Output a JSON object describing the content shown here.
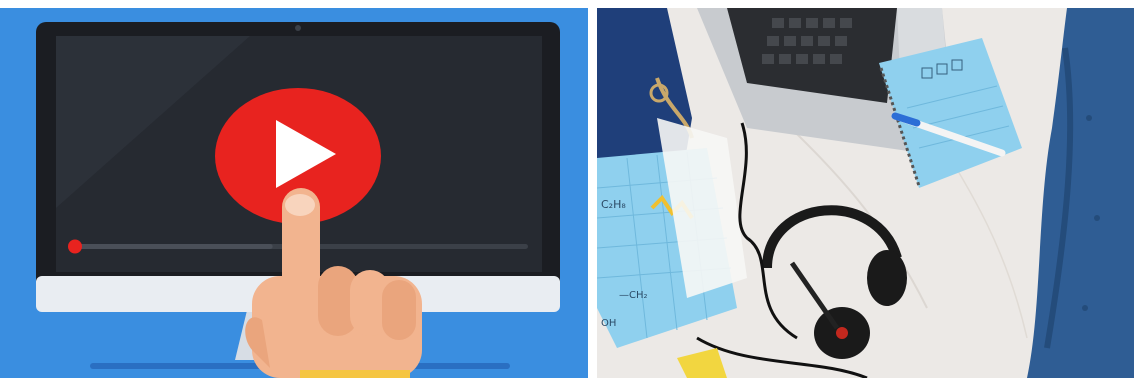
{
  "panels": [
    {
      "id": "video-illustration",
      "kind": "illustration",
      "description_only": false,
      "colors": {
        "background": "#3a8ee0",
        "monitor_frame": "#1b1d22",
        "screen": "#262a31",
        "chin": "#e9edf2",
        "play_button": "#e8231f",
        "progress_dot": "#e8231f",
        "hand": "#f2b48f"
      },
      "video_progress": 0.44
    },
    {
      "id": "desk-photo",
      "kind": "photo",
      "colors": {
        "desk": "#ece9e6",
        "sofa": "#2f5d94",
        "notebook": "#8fd0ee",
        "bag": "#1f3f7a",
        "headset": "#1a1a1a"
      },
      "notebook_text": [
        "C₂H₈",
        "—CH₂",
        "OH"
      ]
    }
  ]
}
